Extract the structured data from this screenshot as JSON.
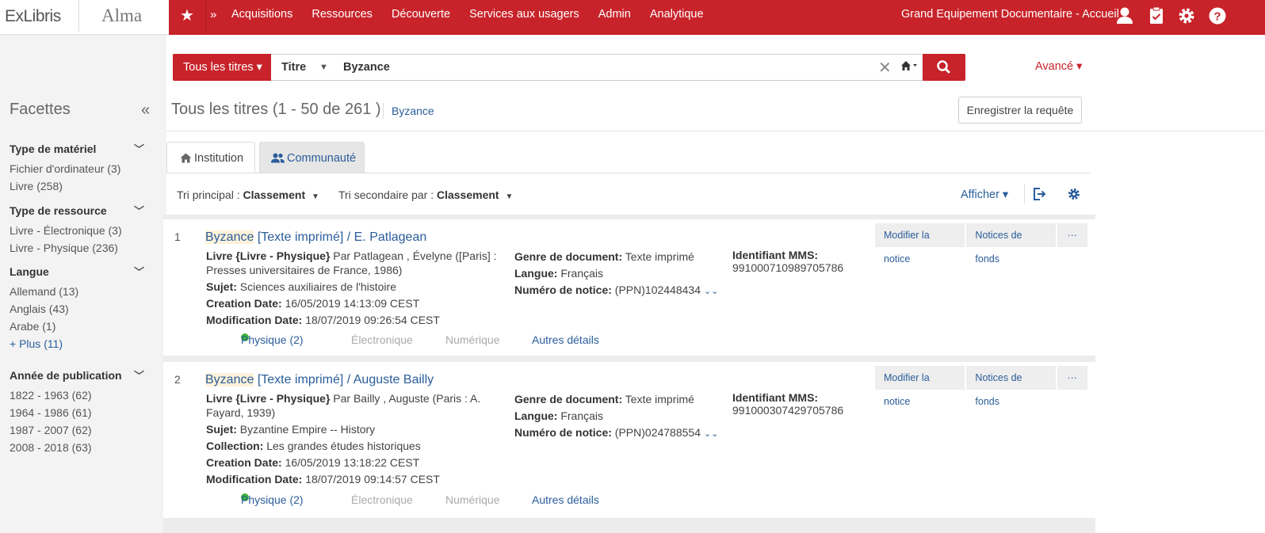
{
  "header": {
    "logo_exlibris": "ExLibris",
    "logo_alma": "Alma",
    "menu": [
      "Acquisitions",
      "Ressources",
      "Découverte",
      "Services aux usagers",
      "Admin",
      "Analytique"
    ],
    "institution": "Grand Equipement Documentaire - Accueil ▾",
    "icons": [
      "star-icon",
      "user-icon",
      "tasks-icon",
      "gear-icon",
      "help-icon"
    ],
    "brand_color": "#c8232a"
  },
  "facets": {
    "title": "Facettes",
    "groups": [
      {
        "label": "Type de matériel",
        "items": [
          "Fichier d'ordinateur (3)",
          "Livre (258)"
        ]
      },
      {
        "label": "Type de ressource",
        "items": [
          "Livre - Électronique (3)",
          "Livre - Physique (236)"
        ]
      },
      {
        "label": "Langue",
        "items": [
          "Allemand (13)",
          "Anglais (43)",
          "Arabe (1)"
        ],
        "more": "+ Plus (11)"
      },
      {
        "label": "Année de publication",
        "items": [
          "1822 - 1963 (62)",
          "1964 - 1986 (61)",
          "1987 - 2007 (62)",
          "2008 - 2018 (63)"
        ]
      }
    ]
  },
  "search": {
    "scope": "Tous les titres ▾",
    "field": "Titre",
    "value": "Byzance",
    "advanced": "Avancé ▾"
  },
  "results": {
    "title": "Tous les titres (1 - 50 de 261 )",
    "query": "Byzance",
    "save_query": "Enregistrer la requête",
    "tabs": [
      "Institution",
      "Communauté"
    ],
    "sort_primary_label": "Tri principal :",
    "sort_primary_value": "Classement",
    "sort_secondary_label": "Tri secondaire par :",
    "sort_secondary_value": "Classement",
    "display": "Afficher ▾",
    "records": [
      {
        "num": "1",
        "title_hl": "Byzance",
        "title_rest": " [Texte imprimé] / E. Patlagean",
        "format": "Livre {Livre - Physique}",
        "desc": "Par Patlagean , Évelyne ([Paris] : Presses universitaires de France, 1986)",
        "extra_label": "Sujet:",
        "extra_value": "Sciences auxiliaires de l'histoire",
        "extra2_label": "",
        "extra2_value": "",
        "creation_label": "Creation Date:",
        "creation": "16/05/2019 14:13:09 CEST",
        "modification_label": "Modification Date:",
        "modification": "18/07/2019 09:26:54 CEST",
        "genre_label": "Genre de document:",
        "genre": "Texte imprimé",
        "langue_label": "Langue:",
        "langue": "Français",
        "notice_label": "Numéro de notice:",
        "notice": "(PPN)102448434",
        "mms_label": "Identifiant MMS:",
        "mms": "991000710989705786",
        "physique": "Physique (2)",
        "electronique": "Électronique",
        "numerique": "Numérique",
        "details": "Autres détails",
        "btn_edit": "Modifier la notice",
        "btn_holdings": "Notices de fonds",
        "btn_more": "···"
      },
      {
        "num": "2",
        "title_hl": "Byzance",
        "title_rest": " [Texte imprimé] / Auguste Bailly",
        "format": "Livre {Livre - Physique}",
        "desc": "Par Bailly , Auguste (Paris : A. Fayard, 1939)",
        "extra_label": "Sujet:",
        "extra_value": "Byzantine Empire -- History",
        "extra2_label": "Collection:",
        "extra2_value": "Les grandes études historiques",
        "creation_label": "Creation Date:",
        "creation": "16/05/2019 13:18:22 CEST",
        "modification_label": "Modification Date:",
        "modification": "18/07/2019 09:14:57 CEST",
        "genre_label": "Genre de document:",
        "genre": "Texte imprimé",
        "langue_label": "Langue:",
        "langue": "Français",
        "notice_label": "Numéro de notice:",
        "notice": "(PPN)024788554",
        "mms_label": "Identifiant MMS:",
        "mms": "991000307429705786",
        "physique": "Physique (2)",
        "electronique": "Électronique",
        "numerique": "Numérique",
        "details": "Autres détails",
        "btn_edit": "Modifier la notice",
        "btn_holdings": "Notices de fonds",
        "btn_more": "···"
      }
    ]
  }
}
